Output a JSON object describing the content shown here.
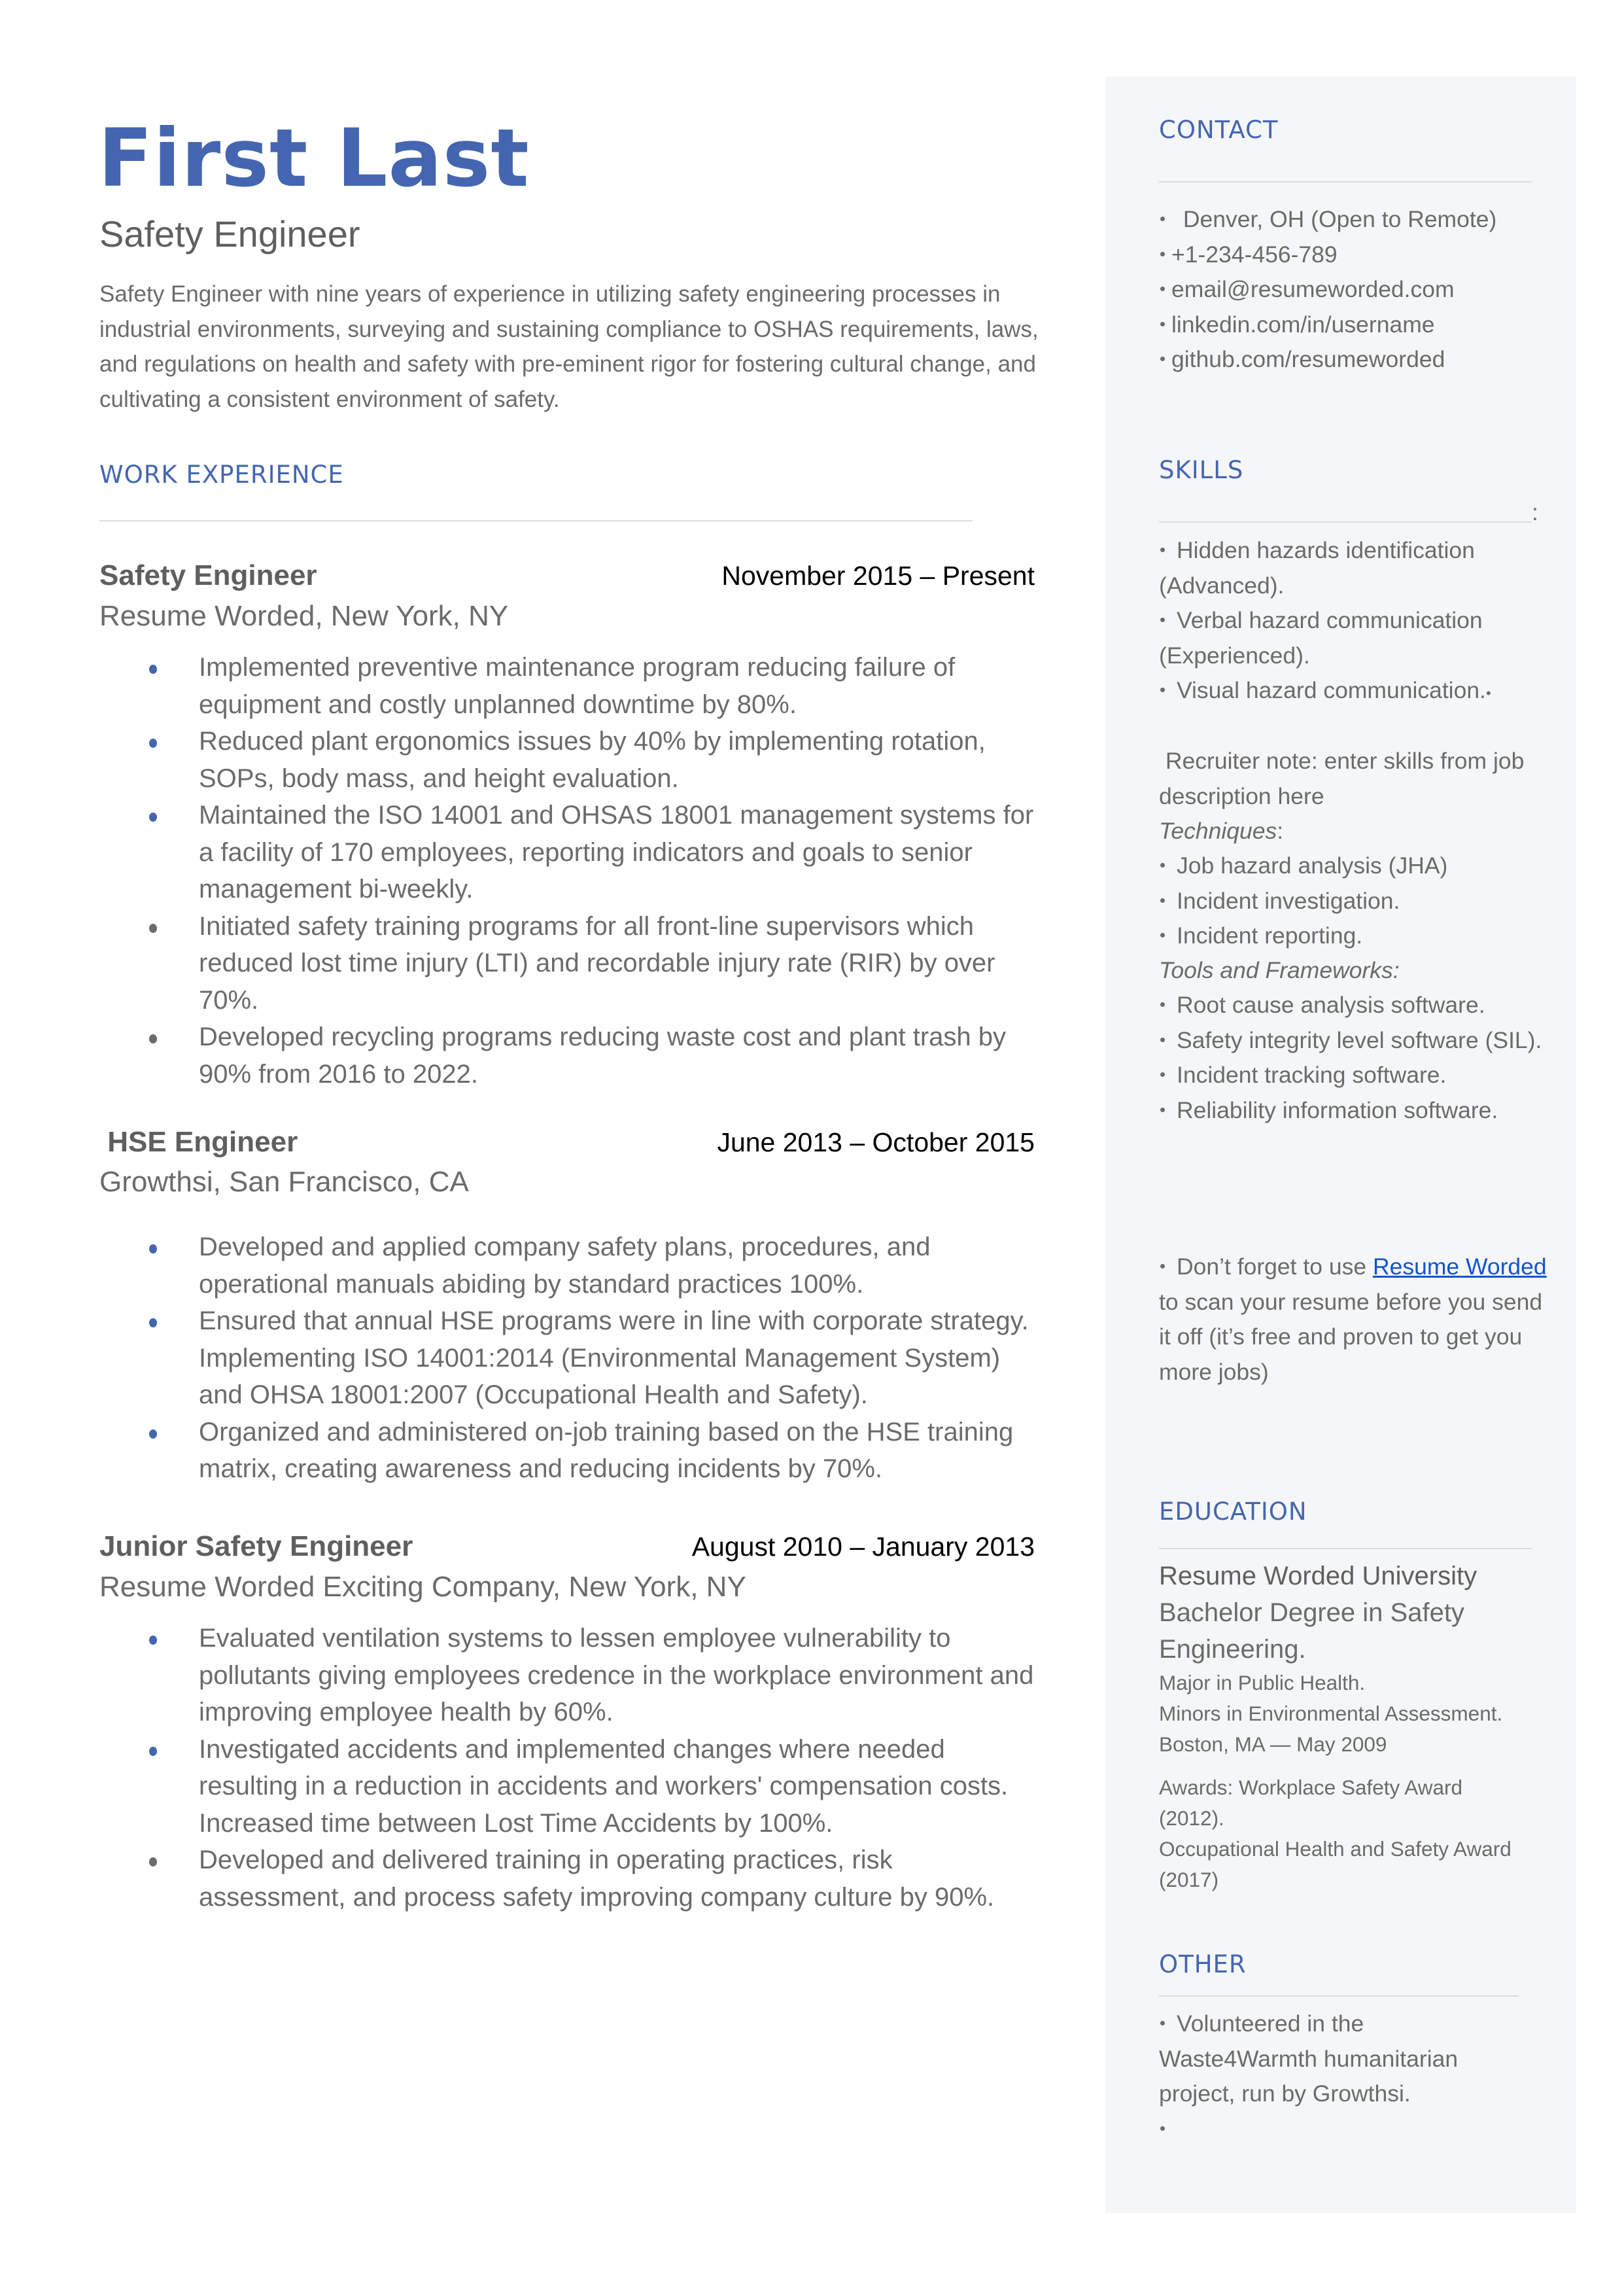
{
  "header": {
    "name": "First Last",
    "title": "Safety Engineer",
    "summary": "Safety Engineer with nine years of experience in utilizing safety engineering processes in industrial environments, surveying and sustaining compliance to OSHAS requirements, laws, and regulations on health and safety with pre-eminent rigor for fostering cultural change, and cultivating a consistent environment of safety."
  },
  "colors": {
    "accent": "#4466b1",
    "sidebar_bg": "#f5f6f8",
    "link": "#1155cc",
    "body_text": "#6b6b6b"
  },
  "work": {
    "heading": "WORK EXPERIENCE",
    "jobs": [
      {
        "role": "Safety Engineer",
        "dates": "November 2015 – Present",
        "company": "Resume Worded, New York, NY",
        "bullets": [
          {
            "text": "Implemented preventive maintenance program reducing failure of equipment and costly unplanned downtime by 80%.",
            "bullet_color": "blue"
          },
          {
            "text": "Reduced plant ergonomics issues by 40% by implementing rotation, SOPs, body mass, and height evaluation.",
            "bullet_color": "blue"
          },
          {
            "text": "Maintained the ISO 14001 and OHSAS 18001 management systems for a facility of 170 employees, reporting indicators and goals to senior management bi-weekly.",
            "bullet_color": "blue"
          },
          {
            "text": "Initiated safety training programs for all front-line supervisors which reduced lost time injury (LTI) and recordable injury rate (RIR) by over 70%.",
            "bullet_color": "gray"
          },
          {
            "text": "Developed recycling programs reducing waste cost and plant trash by 90% from 2016 to 2022.",
            "bullet_color": "gray"
          }
        ]
      },
      {
        "role": " HSE Engineer",
        "dates": "June 2013 – October 2015",
        "company": "Growthsi, San Francisco, CA",
        "bullets": [
          {
            "text": "Developed and applied company safety plans, procedures, and operational manuals abiding by standard practices 100%.",
            "bullet_color": "blue"
          },
          {
            "text": "Ensured that annual HSE programs were in line with corporate strategy. Implementing ISO 14001:2014 (Environmental Management System) and OHSA 18001:2007 (Occupational Health and Safety).",
            "bullet_color": "blue"
          },
          {
            "text": "Organized and administered on-job training based on the HSE training matrix, creating awareness and reducing incidents by 70%.",
            "bullet_color": "blue"
          }
        ]
      },
      {
        "role": "Junior Safety Engineer",
        "dates": "August 2010 – January 2013",
        "company": "Resume Worded Exciting Company, New York, NY",
        "bullets": [
          {
            "text": "Evaluated ventilation systems to lessen employee vulnerability to pollutants giving employees credence in the workplace environment and improving employee health by 60%.",
            "bullet_color": "blue"
          },
          {
            "text": "Investigated accidents and implemented changes where needed resulting in a reduction in accidents and workers' compensation costs. Increased time between Lost Time Accidents by 100%.",
            "bullet_color": "blue"
          },
          {
            "text": "Developed and delivered training in operating practices, risk assessment, and process safety improving company culture by 90%.",
            "bullet_color": "gray"
          }
        ]
      }
    ]
  },
  "sidebar": {
    "contact": {
      "heading": "CONTACT",
      "items": [
        " Denver, OH (Open to Remote)",
        "+1-234-456-789",
        "email@resumeworded.com",
        "linkedin.com/in/username",
        "github.com/resumeworded"
      ]
    },
    "skills": {
      "heading": "SKILLS",
      "rule_suffix": ":",
      "items": [
        "Hidden hazards identification (Advanced).",
        "Verbal hazard communication (Experienced).",
        "Visual hazard communication."
      ],
      "trailing_bullet": "•",
      "recruiter_note": " Recruiter note: enter skills from job description here",
      "techniques_label": "Techniques",
      "techniques_colon": ":",
      "techniques": [
        "Job hazard analysis (JHA)",
        "Incident investigation.",
        "Incident reporting."
      ],
      "tools_label": "Tools and Frameworks:",
      "tools": [
        "Root cause analysis software.",
        "Safety integrity level software (SIL).",
        "Incident tracking software.",
        "Reliability information software."
      ],
      "tip_prefix": "Don’t forget to use ",
      "tip_link": "Resume Worded",
      "tip_suffix": " to scan your resume before you send it off (it’s free and proven to get you more jobs)"
    },
    "education": {
      "heading": "EDUCATION",
      "school": "Resume Worded University",
      "degree": "Bachelor Degree in Safety Engineering.",
      "major": "Major in Public Health.",
      "minors": "Minors in Environmental Assessment.",
      "location_date": "Boston, MA — May 2009",
      "awards_1": "Awards: Workplace Safety Award (2012).",
      "awards_2": "Occupational Health and Safety Award (2017)"
    },
    "other": {
      "heading": "OTHER",
      "items": [
        "Volunteered in the Waste4Warmth humanitarian project, run by Growthsi.",
        ""
      ]
    }
  }
}
